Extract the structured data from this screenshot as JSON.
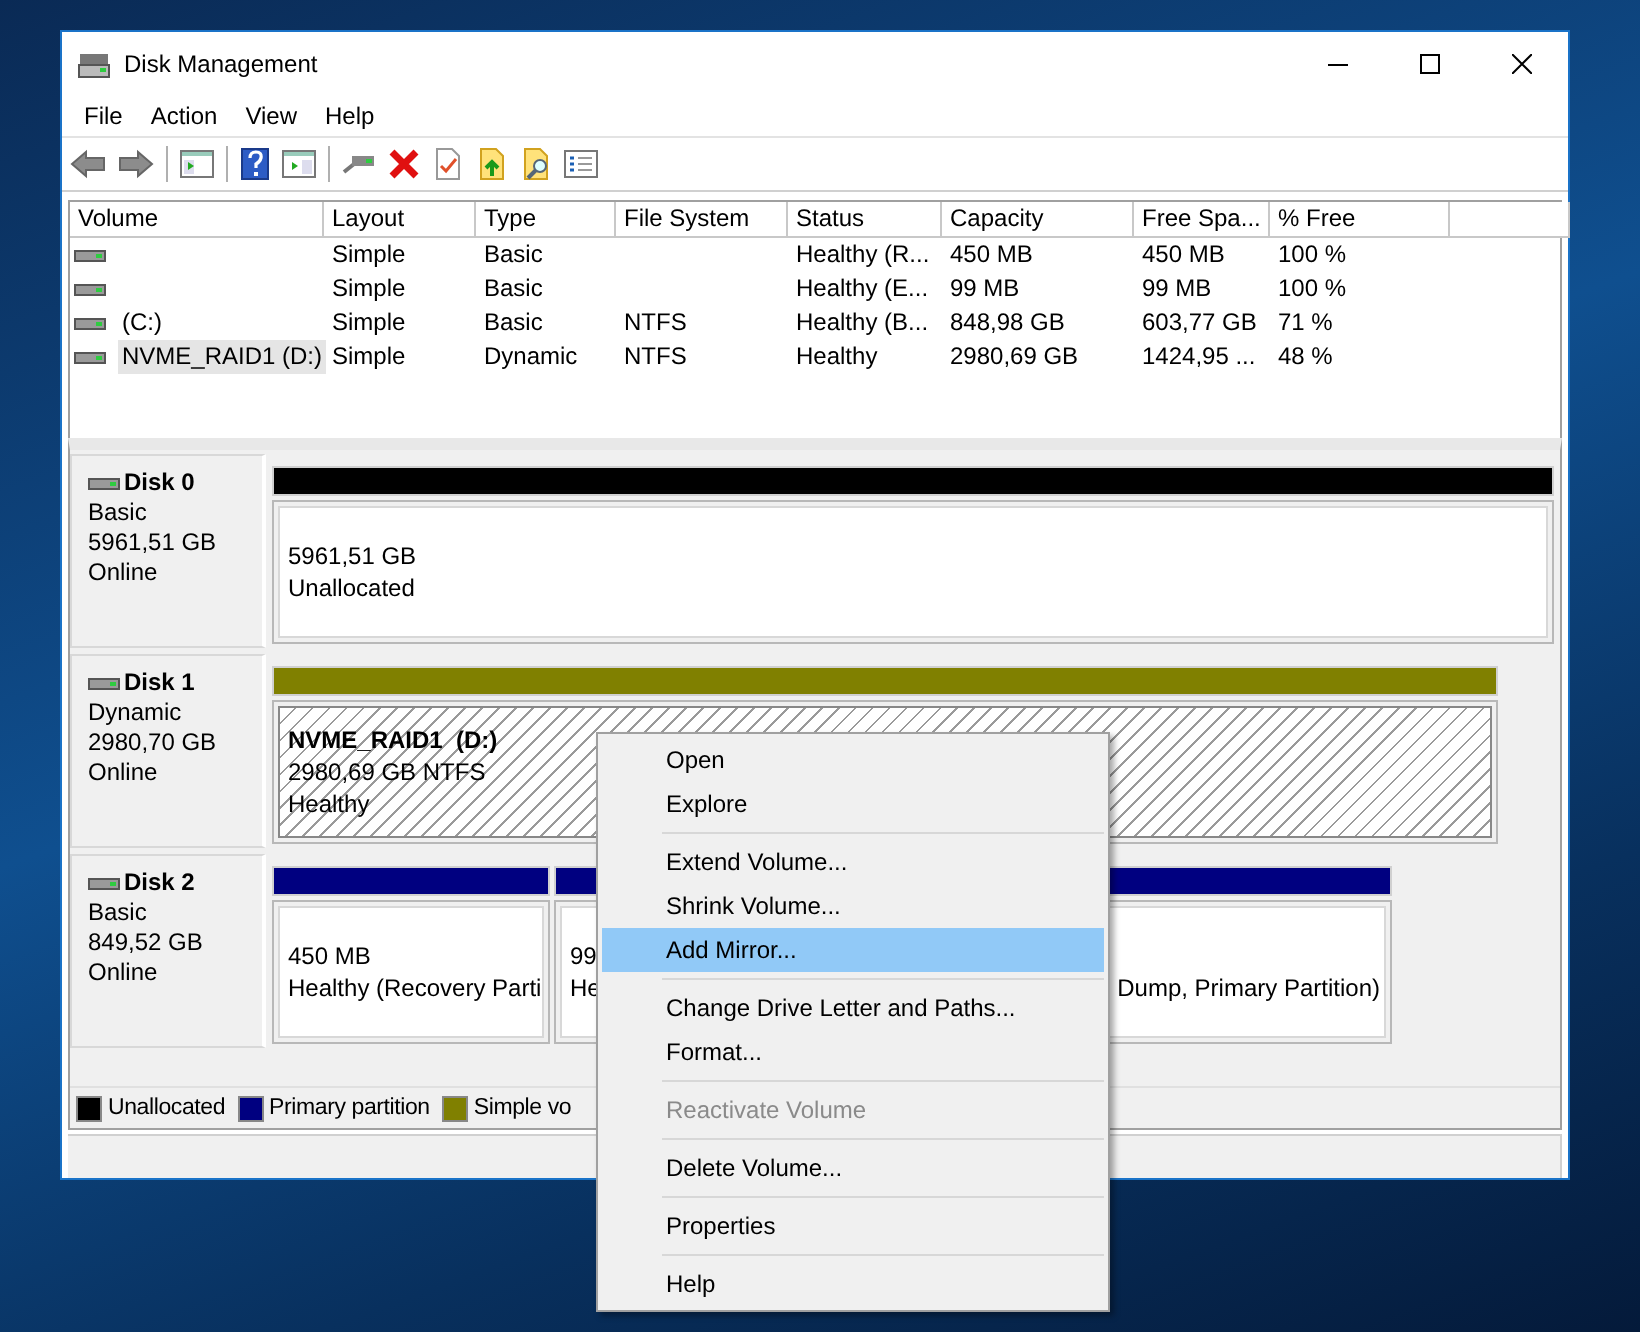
{
  "window": {
    "title": "Disk Management"
  },
  "menu_bar": [
    "File",
    "Action",
    "View",
    "Help"
  ],
  "volume_table": {
    "columns": [
      "Volume",
      "Layout",
      "Type",
      "File System",
      "Status",
      "Capacity",
      "Free Spa...",
      "% Free"
    ],
    "rows": [
      {
        "layout": "Simple",
        "type": "Basic",
        "status": "Healthy (R...",
        "capacity": "450 MB",
        "free_space": "450 MB",
        "percent_free": "100 %",
        "selected": false
      },
      {
        "layout": "Simple",
        "type": "Basic",
        "status": "Healthy (E...",
        "capacity": "99 MB",
        "free_space": "99 MB",
        "percent_free": "100 %",
        "selected": false
      },
      {
        "volume": "(C:)",
        "layout": "Simple",
        "type": "Basic",
        "file_system": "NTFS",
        "status": "Healthy (B...",
        "capacity": "848,98 GB",
        "free_space": "603,77 GB",
        "percent_free": "71 %",
        "selected": false
      },
      {
        "volume": "NVME_RAID1 (D:)",
        "layout": "Simple",
        "type": "Dynamic",
        "file_system": "NTFS",
        "status": "Healthy",
        "capacity": "2980,69 GB",
        "free_space": "1424,95 ...",
        "percent_free": "48 %",
        "selected": true
      }
    ]
  },
  "disks": [
    {
      "name": "Disk 0",
      "type": "Basic",
      "size": "5961,51 GB",
      "status": "Online",
      "partitions": [
        {
          "color": "#000000",
          "lines": [
            "5961,51 GB",
            "Unallocated"
          ],
          "selected": false
        }
      ]
    },
    {
      "name": "Disk 1",
      "type": "Dynamic",
      "size": "2980,70 GB",
      "status": "Online",
      "partitions": [
        {
          "color": "#808000",
          "title": "NVME_RAID1  (D:)",
          "lines": [
            "2980,69 GB NTFS",
            "Healthy"
          ],
          "selected": true
        }
      ]
    },
    {
      "name": "Disk 2",
      "type": "Basic",
      "size": "849,52 GB",
      "status": "Online",
      "partitions": [
        {
          "color": "#000080",
          "lines": [
            "450 MB",
            "Healthy (Recovery Parti"
          ],
          "selected": false
        },
        {
          "color": "#000080",
          "lines": [
            "99",
            "He"
          ],
          "selected": false
        },
        {
          "color": "#000080",
          "lines": [
            "Dump, Primary Partition)"
          ],
          "selected": false
        }
      ]
    }
  ],
  "legend": [
    {
      "label": "Unallocated",
      "color": "#000000"
    },
    {
      "label": "Primary partition",
      "color": "#000080"
    },
    {
      "label": "Simple vo",
      "color": "#808000"
    }
  ],
  "context_menu": [
    {
      "kind": "item",
      "label": "Open",
      "disabled": false,
      "selected": false
    },
    {
      "kind": "item",
      "label": "Explore",
      "disabled": false,
      "selected": false
    },
    {
      "kind": "separator"
    },
    {
      "kind": "item",
      "label": "Extend Volume...",
      "disabled": false,
      "selected": false
    },
    {
      "kind": "item",
      "label": "Shrink Volume...",
      "disabled": false,
      "selected": false
    },
    {
      "kind": "item",
      "label": "Add Mirror...",
      "disabled": false,
      "selected": true
    },
    {
      "kind": "separator"
    },
    {
      "kind": "item",
      "label": "Change Drive Letter and Paths...",
      "disabled": false,
      "selected": false
    },
    {
      "kind": "item",
      "label": "Format...",
      "disabled": false,
      "selected": false
    },
    {
      "kind": "separator"
    },
    {
      "kind": "item",
      "label": "Reactivate Volume",
      "disabled": true,
      "selected": false
    },
    {
      "kind": "separator"
    },
    {
      "kind": "item",
      "label": "Delete Volume...",
      "disabled": false,
      "selected": false
    },
    {
      "kind": "separator"
    },
    {
      "kind": "item",
      "label": "Properties",
      "disabled": false,
      "selected": false
    },
    {
      "kind": "separator"
    },
    {
      "kind": "item",
      "label": "Help",
      "disabled": false,
      "selected": false
    }
  ]
}
